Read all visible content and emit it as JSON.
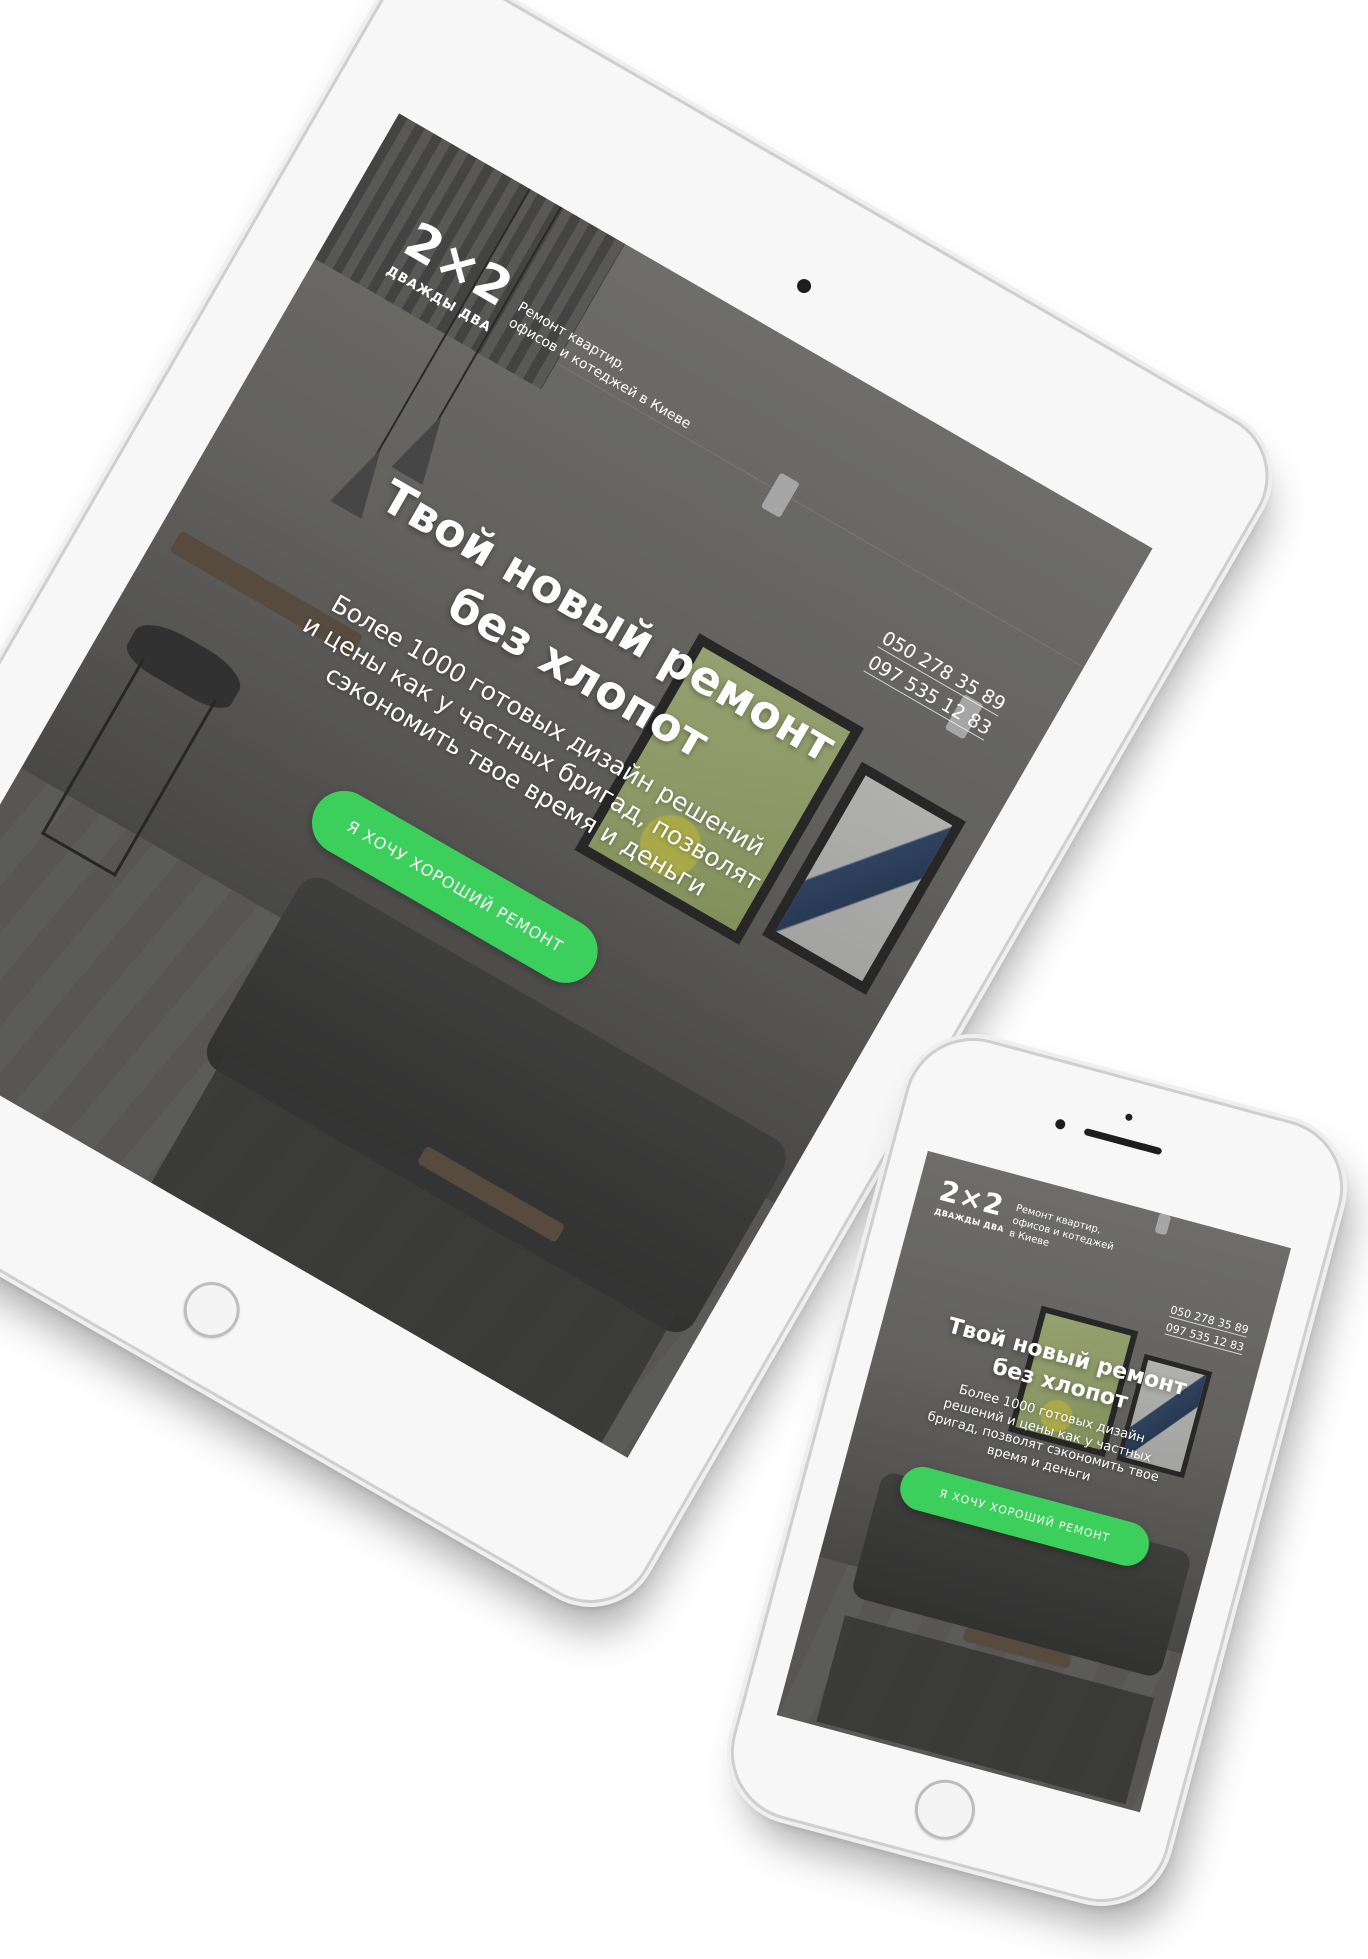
{
  "site": {
    "logo": "2×2",
    "logo_subtitle": "ДВАЖДЫ ДВА",
    "tagline": "Ремонт квартир, офисов и котеджей в Киеве",
    "phones": [
      "050 278 35 89",
      "097 535 12 83"
    ],
    "headline_line1": "Твой новый ремонт",
    "headline_line2": "без хлопот",
    "subtext_tablet_lines": [
      "Более 1000 готовых дизайн решений",
      "и цены как у частных бригад,  позволят",
      "сэкономить твое время и деньги"
    ],
    "subtext_phone_lines": [
      "Более 1000 готовых дизайн",
      "решений и цены как у частных",
      "бригад, позволят сэкономить  твое",
      "время и деньги"
    ],
    "tagline_phone_lines": [
      "Ремонт квартир,",
      "офисов и котеджей",
      "в Киеве"
    ],
    "tagline_tablet_lines": [
      "Ремонт квартир,",
      "офисов и котеджей в Киеве"
    ],
    "cta_label": "Я ХОЧУ ХОРОШИЙ РЕМОНТ"
  },
  "colors": {
    "accent": "#3ccf5c",
    "device_body": "#f7f7f7",
    "text": "#ffffff"
  }
}
